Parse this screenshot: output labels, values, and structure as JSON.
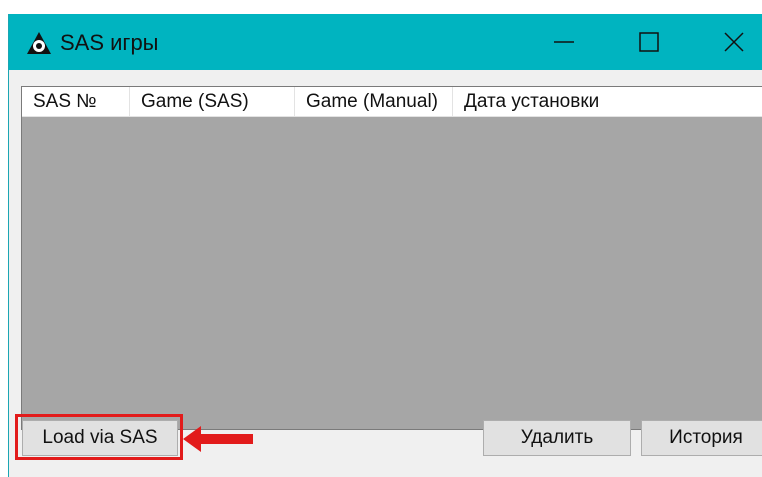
{
  "window": {
    "title": "SAS игры",
    "icon": "sas-app-icon",
    "controls": [
      "minimize-icon",
      "maximize-icon",
      "close-icon"
    ]
  },
  "table": {
    "columns": [
      "SAS №",
      "Game (SAS)",
      "Game (Manual)",
      "Дата установки"
    ],
    "rows": []
  },
  "buttons": {
    "load": "Load via SAS",
    "delete": "Удалить",
    "history": "История"
  },
  "annotation": {
    "highlight_color": "#e21b1b",
    "arrow_icon": "left-arrow-icon"
  },
  "colors": {
    "titlebar": "#00b4c0",
    "list_background": "#a6a6a6"
  }
}
